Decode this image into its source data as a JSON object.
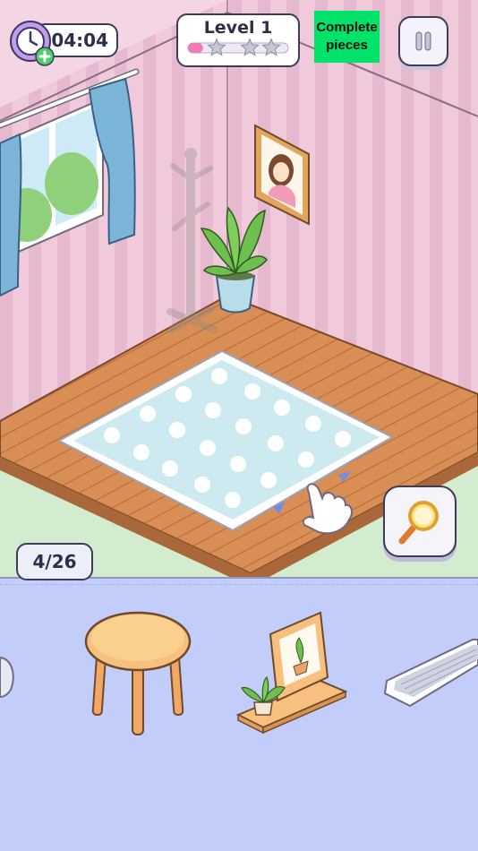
{
  "hud": {
    "timer": "04:04",
    "level_label": "Level 1",
    "level_progress": 0.15,
    "stars_earned": 0,
    "stars_total": 3,
    "complete_button_label": "Complete pieces",
    "pieces_counter": "4/26"
  },
  "icons": {
    "clock": "clock-icon",
    "add_time": "plus-icon",
    "pause": "pause-icon",
    "hint": "magnifier-icon"
  },
  "tray": {
    "items": [
      "stool",
      "plant-with-picture-frame-shelf",
      "keyboard"
    ]
  },
  "colors": {
    "wall": "#f0c9da",
    "floor": "#d78e55",
    "rug": "#cdeaf0",
    "tray": "#c3cdfa",
    "complete_button": "#00e36a",
    "level_bar": "#f27bb6"
  }
}
